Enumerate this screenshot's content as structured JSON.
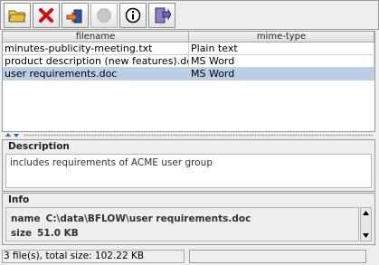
{
  "toolbar": {
    "buttons": [
      {
        "icon": "open-folder-icon",
        "enabled": true
      },
      {
        "icon": "delete-x-icon",
        "enabled": true
      },
      {
        "icon": "import-icon",
        "enabled": true
      },
      {
        "icon": "stop-icon",
        "enabled": false
      },
      {
        "icon": "info-icon",
        "enabled": true
      },
      {
        "icon": "exit-door-icon",
        "enabled": true
      }
    ]
  },
  "table": {
    "columns": [
      "filename",
      "mime-type"
    ],
    "rows": [
      {
        "filename": "minutes-publicity-meeting.txt",
        "mime": "Plain text",
        "selected": false
      },
      {
        "filename": "product description (new features).doc",
        "mime": "MS Word",
        "selected": false
      },
      {
        "filename": "user requirements.doc",
        "mime": "MS Word",
        "selected": true
      }
    ]
  },
  "description": {
    "title": "Description",
    "text": "includes requirements of ACME user group"
  },
  "info": {
    "title": "Info",
    "name_label": "name",
    "name_value": "C:\\data\\BFLOW\\user requirements.doc",
    "size_label": "size",
    "size_value": "51.0 KB"
  },
  "status": {
    "text": "3 file(s), total size: 102.22 KB",
    "progress": 0
  },
  "colors": {
    "selection": "#b8cfe5",
    "window_bg": "#eeeeee"
  }
}
